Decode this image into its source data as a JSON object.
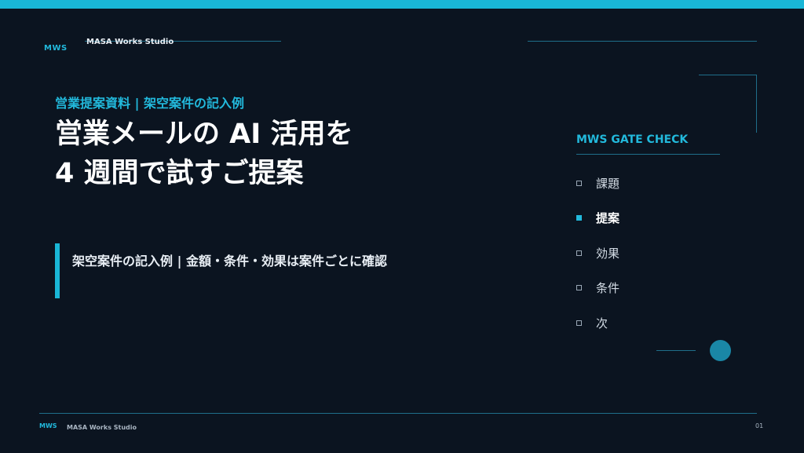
{
  "brand": {
    "logo": "MWS",
    "studio": "MASA Works Studio",
    "accent_color": "#19b6d6"
  },
  "slide": {
    "eyebrow": "営業提案資料 | 架空案件の記入例",
    "title_line1": "営業メールの AI 活用を",
    "title_line2": "4 週間で試すご提案",
    "subtitle": "架空案件の記入例 | 金額・条件・効果は案件ごとに確認"
  },
  "gate_check": {
    "title": "MWS GATE CHECK",
    "items": [
      {
        "label": "課題",
        "active": false
      },
      {
        "label": "提案",
        "active": true
      },
      {
        "label": "効果",
        "active": false
      },
      {
        "label": "条件",
        "active": false
      },
      {
        "label": "次",
        "active": false
      }
    ]
  },
  "footer": {
    "logo": "MWS",
    "studio": "MASA Works Studio",
    "page_number": "01"
  }
}
